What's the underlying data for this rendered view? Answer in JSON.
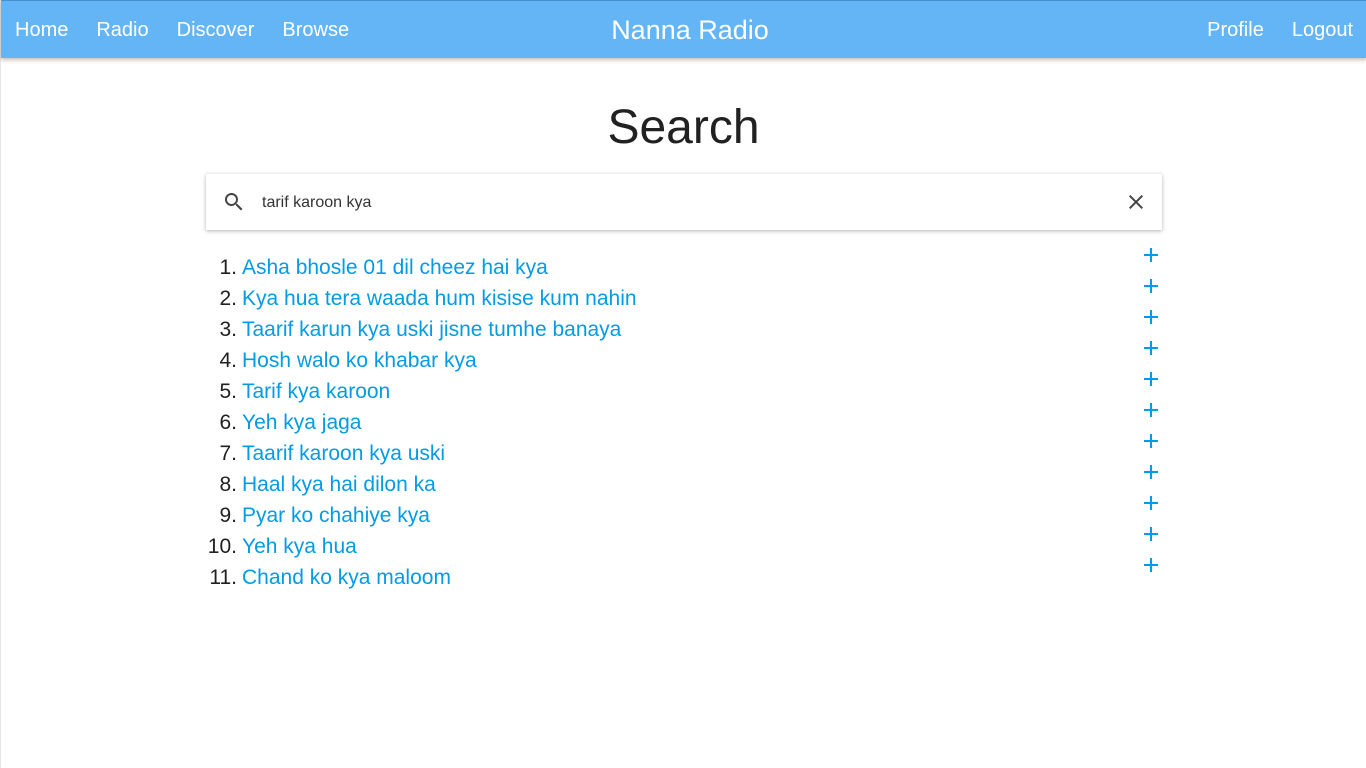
{
  "nav": {
    "left": [
      "Home",
      "Radio",
      "Discover",
      "Browse"
    ],
    "brand": "Nanna Radio",
    "right": [
      "Profile",
      "Logout"
    ]
  },
  "page": {
    "title": "Search"
  },
  "search": {
    "value": "tarif karoon kya",
    "icon": "search-icon",
    "clear_icon": "close-icon"
  },
  "results": [
    {
      "num": "1.",
      "title": "Asha bhosle 01 dil cheez hai kya"
    },
    {
      "num": "2.",
      "title": "Kya hua tera waada hum kisise kum nahin"
    },
    {
      "num": "3.",
      "title": "Taarif karun kya uski jisne tumhe banaya"
    },
    {
      "num": "4.",
      "title": "Hosh walo ko khabar kya"
    },
    {
      "num": "5.",
      "title": "Tarif kya karoon"
    },
    {
      "num": "6.",
      "title": "Yeh kya jaga"
    },
    {
      "num": "7.",
      "title": "Taarif karoon kya uski"
    },
    {
      "num": "8.",
      "title": "Haal kya hai dilon ka"
    },
    {
      "num": "9.",
      "title": "Pyar ko chahiye kya"
    },
    {
      "num": "10.",
      "title": "Yeh kya hua"
    },
    {
      "num": "11.",
      "title": "Chand ko kya maloom"
    }
  ],
  "colors": {
    "navbar": "#64b5f6",
    "link": "#039be5",
    "add": "#039be5"
  }
}
